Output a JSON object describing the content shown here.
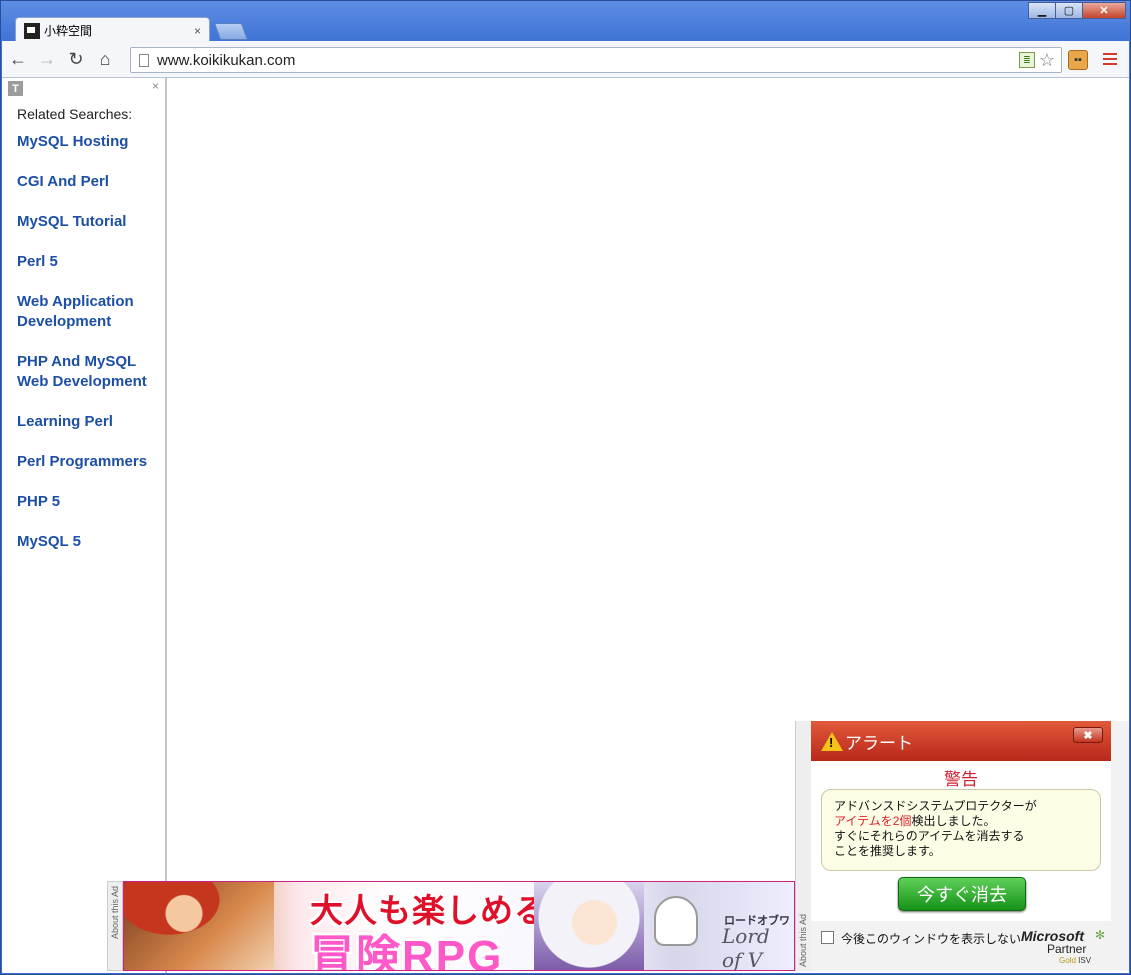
{
  "window": {
    "minimize_label": "▁",
    "maximize_label": "▢",
    "close_label": "✕"
  },
  "tab": {
    "title": "小粋空間",
    "close_label": "×"
  },
  "toolbar": {
    "back_label": "←",
    "forward_label": "→",
    "reload_label": "↻",
    "home_label": "⌂",
    "url": "www.koikikukan.com",
    "star_label": "☆",
    "rss_label": "≣",
    "extension_label": "▪▪"
  },
  "sidebar": {
    "t_icon_label": "T",
    "close_label": "×",
    "heading": "Related Searches:",
    "links": [
      "MySQL Hosting",
      "CGI And Perl",
      "MySQL Tutorial",
      "Perl 5",
      "Web Application Development",
      "PHP And MySQL Web Development",
      "Learning Perl",
      "Perl Programmers",
      "PHP 5",
      "MySQL 5"
    ]
  },
  "banner": {
    "about_label": "About this Ad",
    "line1": "大人も楽しめる",
    "line2": "冒険RPG",
    "subtitle_jp": "ロードオブワ",
    "logo": "Lord of V"
  },
  "alert": {
    "about_label": "About this Ad",
    "outer_close_label": "X",
    "title": "アラート",
    "close_label": "✖",
    "heading": "警告",
    "message_line1": "アドバンスドシステムプロテクターが",
    "message_red": "アイテムを2個",
    "message_line2_rest": "検出しました。",
    "message_line3": "すぐにそれらのアイテムを消去する",
    "message_line4": "ことを推奨します。",
    "button_label": "今すぐ消去",
    "checkbox_label": "今後このウィンドウを表示しない",
    "ms_logo": "Microsoft",
    "ms_partner": "Partner",
    "ms_gold": "Gold",
    "ms_isv": "ISV",
    "ms_star": "✻"
  },
  "colors": {
    "link": "#1c4fa5",
    "alert_red": "#e0202a",
    "alert_button": "#169218",
    "titlebar": "#3a6ccf"
  }
}
